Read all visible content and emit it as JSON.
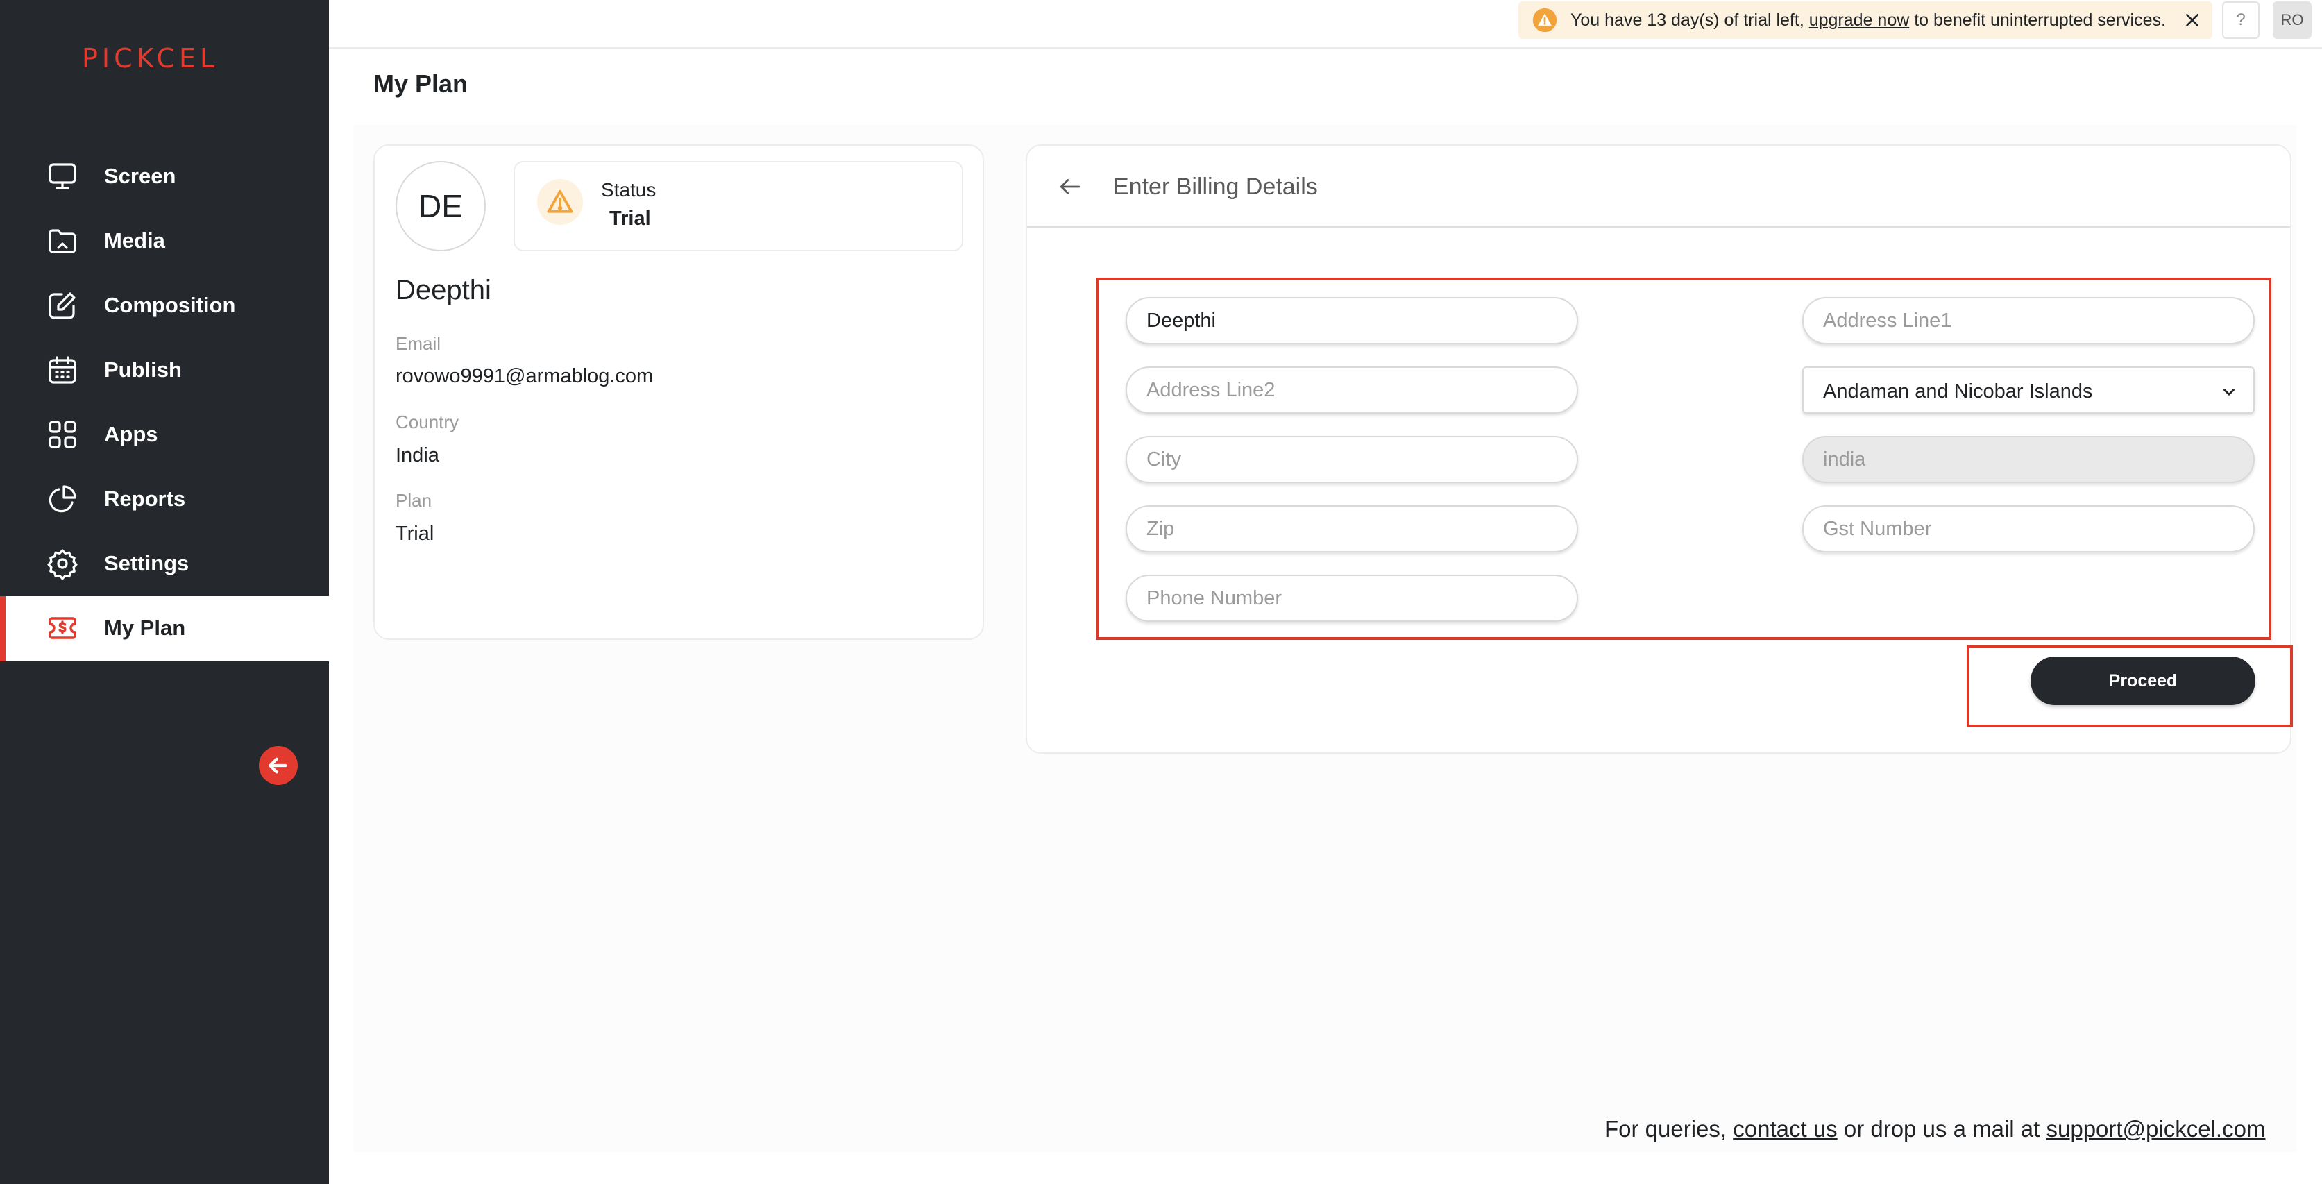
{
  "app": {
    "logo_text": "PICKCEL",
    "colors": {
      "brand": "#e23a2e",
      "sidebar_bg": "#25282c",
      "warning": "#f2a33a",
      "highlight": "#d93a2a"
    }
  },
  "sidebar": {
    "items": [
      {
        "label": "Screen",
        "icon": "monitor-icon"
      },
      {
        "label": "Media",
        "icon": "folder-icon"
      },
      {
        "label": "Composition",
        "icon": "edit-icon"
      },
      {
        "label": "Publish",
        "icon": "calendar-icon"
      },
      {
        "label": "Apps",
        "icon": "grid-icon"
      },
      {
        "label": "Reports",
        "icon": "pie-chart-icon"
      },
      {
        "label": "Settings",
        "icon": "gear-icon"
      },
      {
        "label": "My Plan",
        "icon": "dollar-ticket-icon",
        "active": true
      }
    ]
  },
  "topbar": {
    "trial_prefix": "You have 13 day(s) of trial left, ",
    "trial_link": "upgrade now",
    "trial_suffix": " to benefit uninterrupted services.",
    "help_label": "?",
    "user_initials": "RO"
  },
  "page": {
    "title": "My Plan"
  },
  "profile": {
    "initials": "DE",
    "status_label": "Status",
    "status_value": "Trial",
    "name": "Deepthi",
    "email_label": "Email",
    "email": "rovowo9991@armablog.com",
    "country_label": "Country",
    "country": "India",
    "plan_label": "Plan",
    "plan": "Trial"
  },
  "billing": {
    "title": "Enter Billing Details",
    "name_value": "Deepthi",
    "address1_placeholder": "Address Line1",
    "address2_placeholder": "Address Line2",
    "state_value": "Andaman and Nicobar Islands",
    "city_placeholder": "City",
    "country_placeholder": "india",
    "zip_placeholder": "Zip",
    "gst_placeholder": "Gst Number",
    "phone_placeholder": "Phone Number",
    "proceed_label": "Proceed"
  },
  "footer": {
    "prefix": "For queries, ",
    "contact_link": "contact us",
    "middle": " or drop us a mail at ",
    "email_link": "support@pickcel.com"
  }
}
